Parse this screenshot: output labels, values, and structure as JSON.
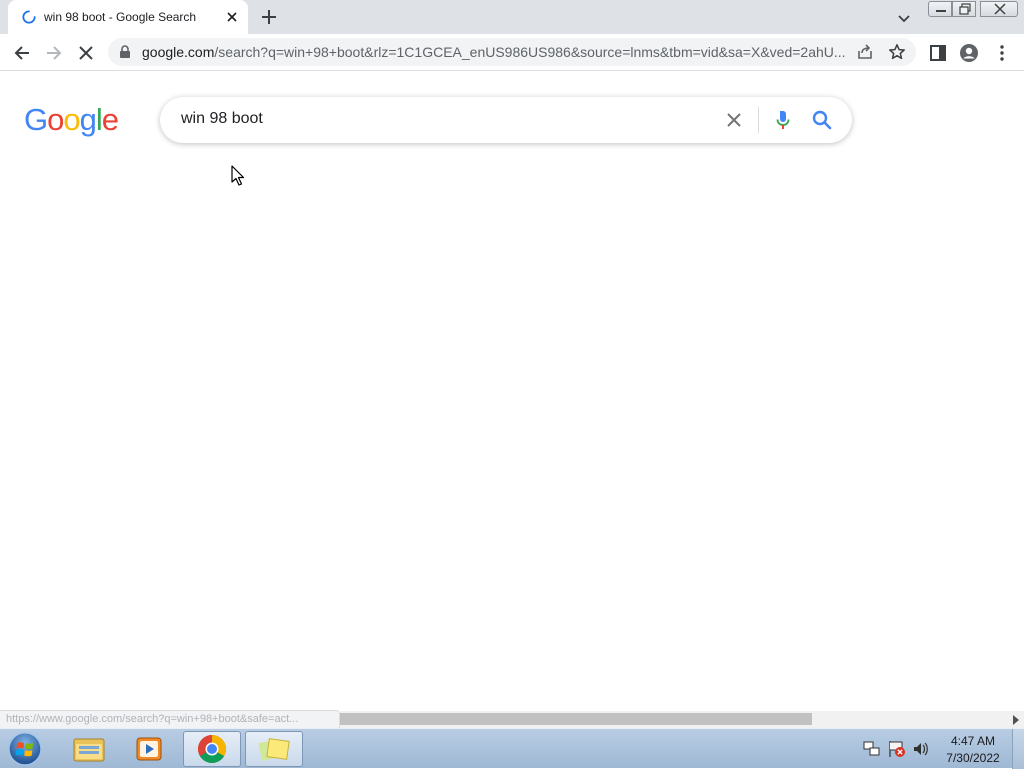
{
  "browser": {
    "tab": {
      "title": "win 98 boot - Google Search",
      "loading_icon": "spinner-icon",
      "close_icon": "close-icon"
    },
    "new_tab_icon": "plus-icon",
    "url_host": "google.com",
    "url_rest": "/search?q=win+98+boot&rlz=1C1GCEA_enUS986US986&source=lnms&tbm=vid&sa=X&ved=2ahU...",
    "status_url": "https://www.google.com/search?q=win+98+boot&safe=act..."
  },
  "google": {
    "logo_letters": [
      "G",
      "o",
      "o",
      "g",
      "l",
      "e"
    ],
    "logo_colors": [
      "#4285f4",
      "#ea4335",
      "#fbbc05",
      "#4285f4",
      "#34a853",
      "#ea4335"
    ],
    "query": "win 98 boot"
  },
  "taskbar": {
    "time": "4:47 AM",
    "date": "7/30/2022",
    "apps": [
      "windows-explorer-icon",
      "media-player-icon",
      "chrome-icon",
      "sticky-notes-icon"
    ]
  }
}
